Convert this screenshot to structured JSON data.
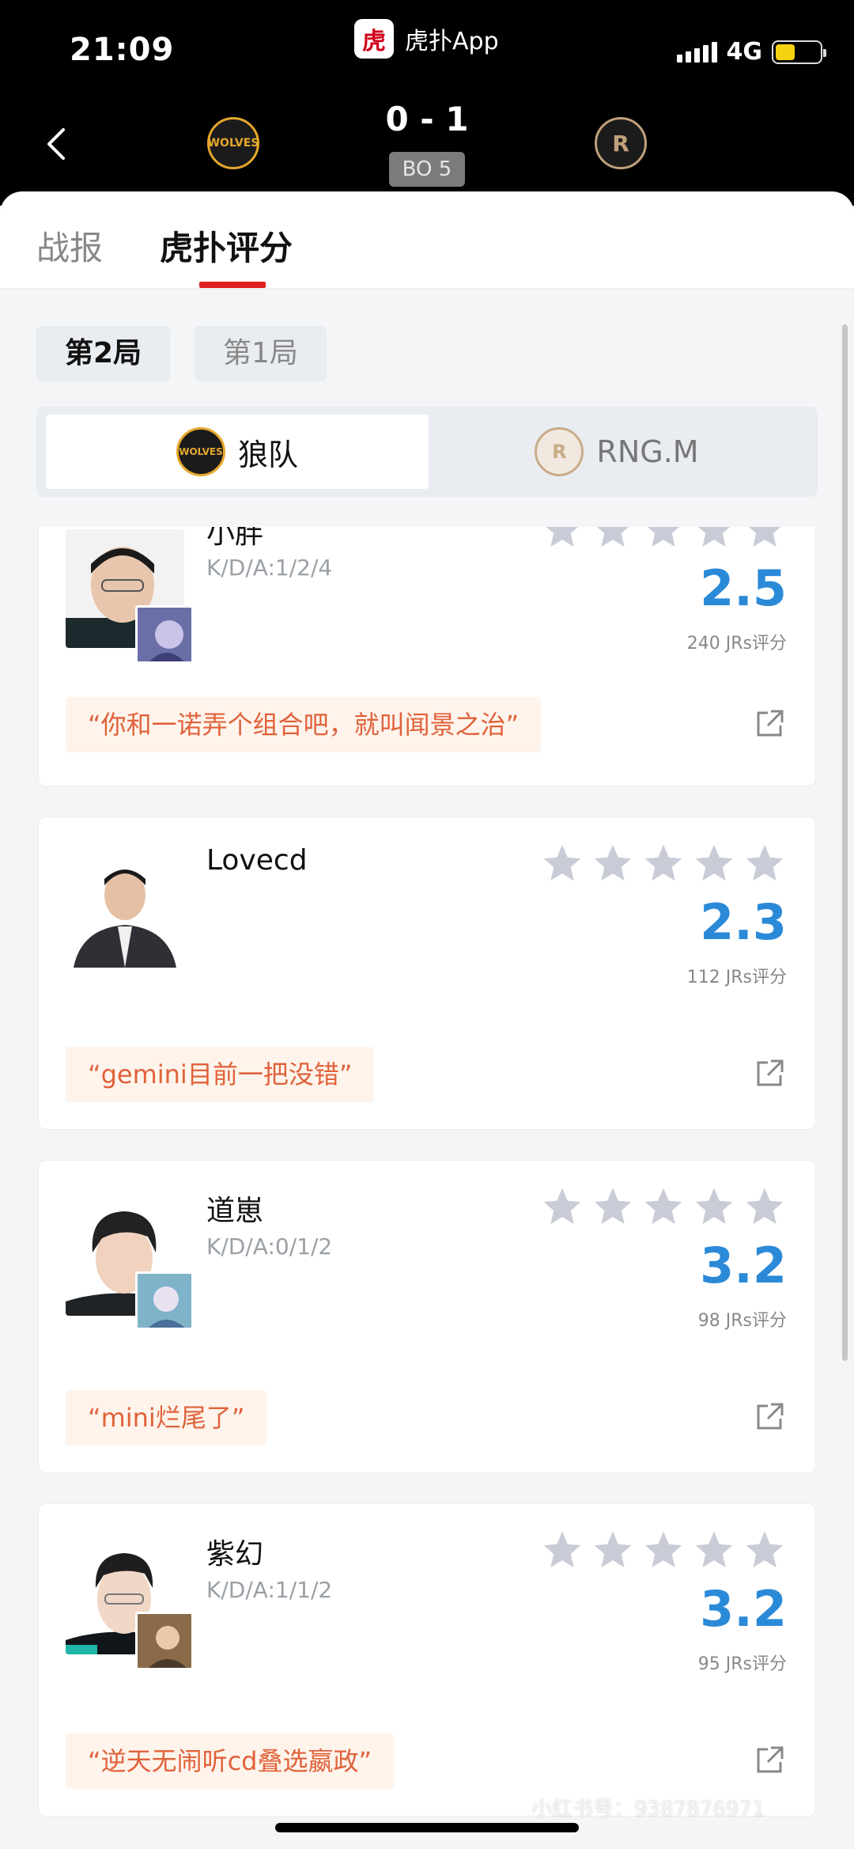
{
  "status_bar": {
    "time": "21:09",
    "network": "4G",
    "app_name": "虎扑App",
    "app_logo": "虎"
  },
  "match": {
    "score": "0 - 1",
    "format": "BO 5",
    "team_a_short": "WOLVES",
    "team_b_short": "R"
  },
  "tabs": [
    {
      "label": "战报"
    },
    {
      "label": "虎扑评分"
    }
  ],
  "rounds": [
    {
      "label": "第2局"
    },
    {
      "label": "第1局"
    }
  ],
  "teams": [
    {
      "name": "狼队",
      "badge": "WOLVES"
    },
    {
      "name": "RNG.M",
      "badge": "R"
    }
  ],
  "players": [
    {
      "name": "小胖",
      "kda": "K/D/A:1/2/4",
      "rating": "2.5",
      "votes": "240 JRs评分",
      "quote": "“你和一诺弄个组合吧，就叫闻景之治”",
      "hero_color": "#6a6fa8"
    },
    {
      "name": "Lovecd",
      "kda": "",
      "rating": "2.3",
      "votes": "112 JRs评分",
      "quote": "“gemini目前一把没错”",
      "hero_color": ""
    },
    {
      "name": "道崽",
      "kda": "K/D/A:0/1/2",
      "rating": "3.2",
      "votes": "98 JRs评分",
      "quote": "“mini烂尾了”",
      "hero_color": "#7fb3c9"
    },
    {
      "name": "紫幻",
      "kda": "K/D/A:1/1/2",
      "rating": "3.2",
      "votes": "95 JRs评分",
      "quote": "“逆天无闹听cd叠选嬴政”",
      "hero_color": "#8b6a4a"
    }
  ],
  "watermark": "小红书号：9387876971",
  "colors": {
    "accent_red": "#e02020",
    "rating_blue": "#2b8ad8",
    "quote_orange": "#e0623a",
    "star_grey": "#c9ccd6"
  }
}
